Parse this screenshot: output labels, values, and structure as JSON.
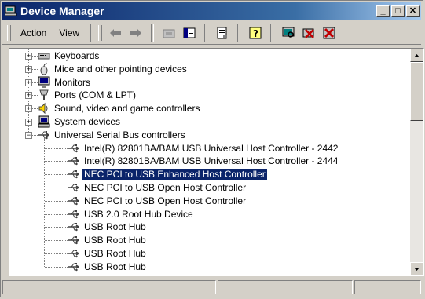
{
  "window": {
    "title": "Device Manager"
  },
  "title_buttons": {
    "minimize": "_",
    "maximize": "□",
    "close": "✕"
  },
  "menu": {
    "action": "Action",
    "view": "View"
  },
  "tree": {
    "categories": [
      {
        "label": "Keyboards",
        "expander": "+",
        "icon": "keyboard-icon"
      },
      {
        "label": "Mice and other pointing devices",
        "expander": "+",
        "icon": "mouse-icon"
      },
      {
        "label": "Monitors",
        "expander": "+",
        "icon": "monitor-icon"
      },
      {
        "label": "Ports (COM & LPT)",
        "expander": "+",
        "icon": "port-icon"
      },
      {
        "label": "Sound, video and game controllers",
        "expander": "+",
        "icon": "sound-icon"
      },
      {
        "label": "System devices",
        "expander": "+",
        "icon": "computer-icon"
      },
      {
        "label": "Universal Serial Bus controllers",
        "expander": "−",
        "icon": "usb-icon"
      }
    ],
    "usb_devices": [
      "Intel(R) 82801BA/BAM USB Universal Host Controller - 2442",
      "Intel(R) 82801BA/BAM USB Universal Host Controller - 2444",
      "NEC PCI to USB Enhanced Host Controller",
      "NEC PCI to USB Open Host Controller",
      "NEC PCI to USB Open Host Controller",
      "USB 2.0 Root Hub Device",
      "USB Root Hub",
      "USB Root Hub",
      "USB Root Hub",
      "USB Root Hub"
    ],
    "selected_device": "NEC PCI to USB Enhanced Host Controller"
  },
  "colors": {
    "selection": "#0a246a",
    "title_start": "#0a246a",
    "title_end": "#a6caf0"
  }
}
